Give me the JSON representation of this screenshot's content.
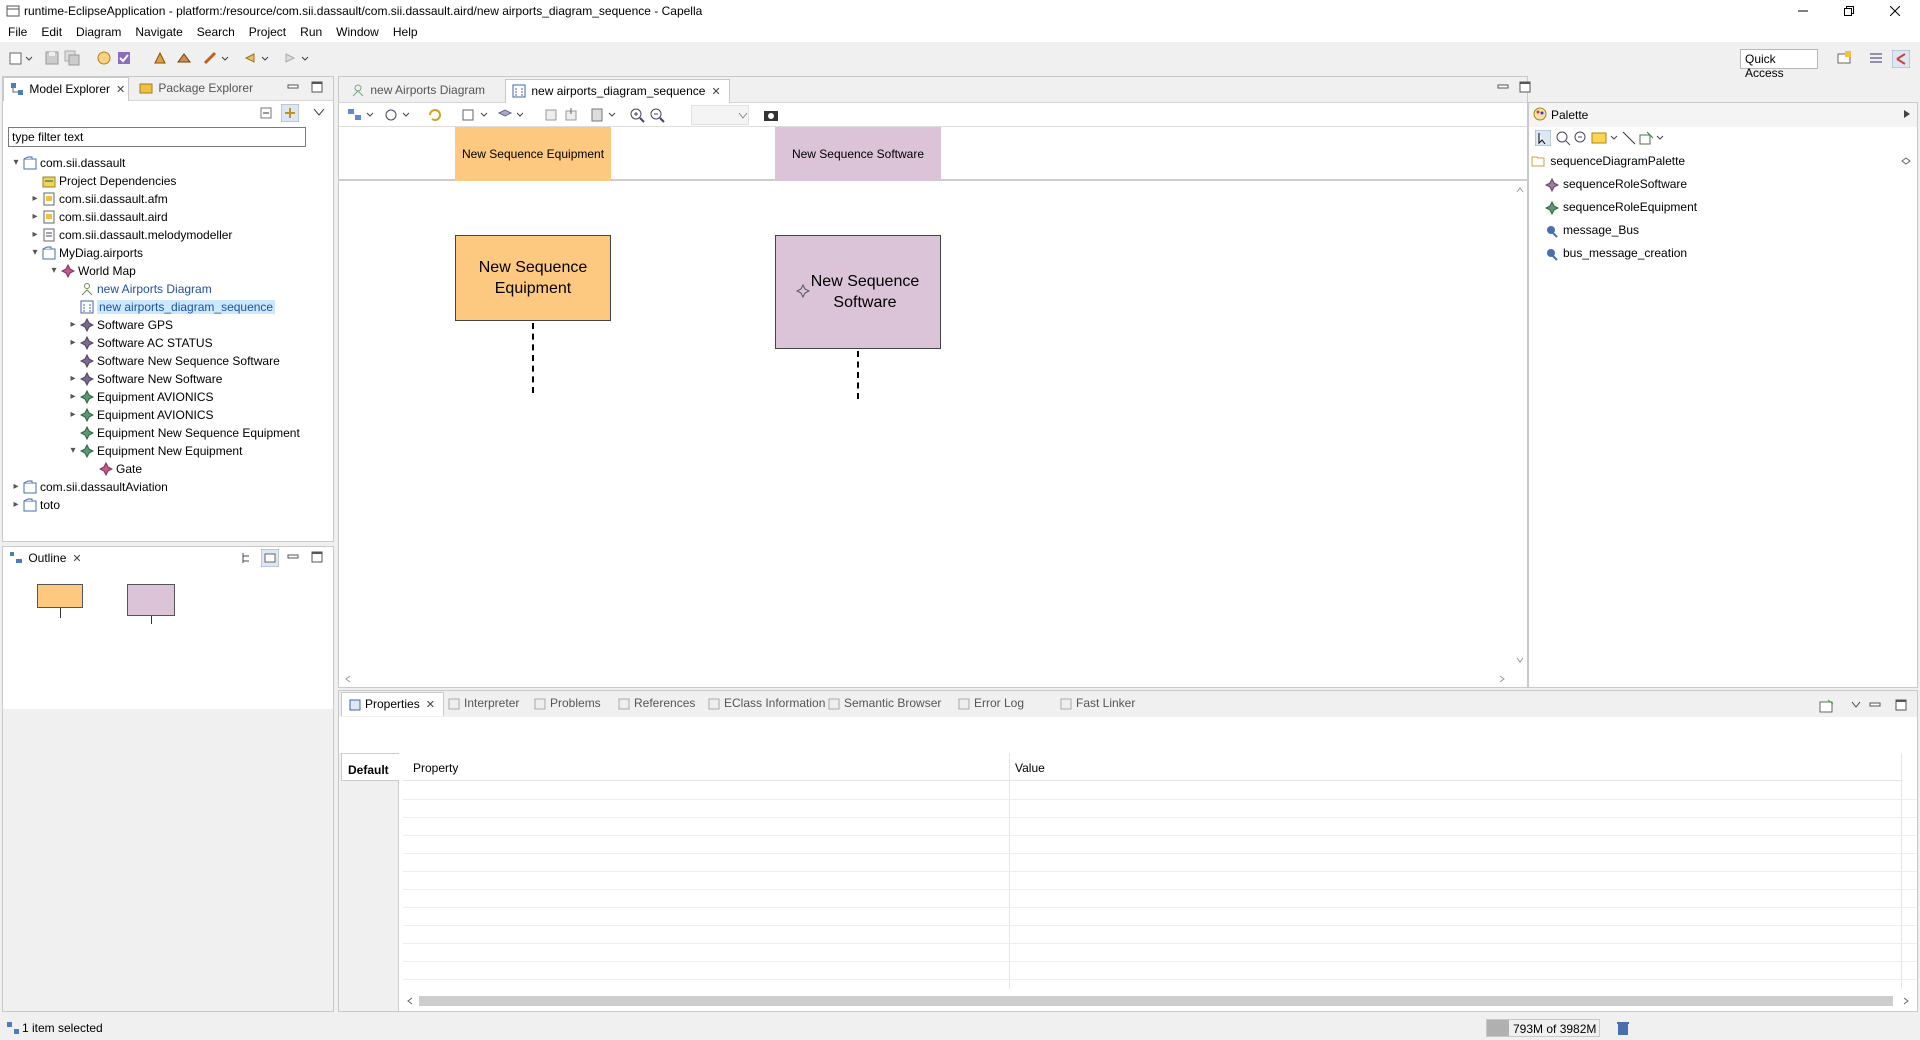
{
  "window": {
    "title": "runtime-EclipseApplication - platform:/resource/com.sii.dassault/com.sii.dassault.aird/new airports_diagram_sequence - Capella"
  },
  "menu": [
    "File",
    "Edit",
    "Diagram",
    "Navigate",
    "Search",
    "Project",
    "Run",
    "Window",
    "Help"
  ],
  "toolbar": {
    "quick_access": "Quick Access"
  },
  "model_explorer": {
    "tabs": [
      "Model Explorer",
      "Package Explorer"
    ],
    "filter_placeholder": "type filter text",
    "tree": [
      {
        "label": "com.sii.dassault",
        "arrow": "▾",
        "icon": "project-icon"
      },
      {
        "label": "Project Dependencies",
        "arrow": "",
        "icon": "dependencies-icon"
      },
      {
        "label": "com.sii.dassault.afm",
        "arrow": "▸",
        "icon": "file-icon"
      },
      {
        "label": "com.sii.dassault.aird",
        "arrow": "▸",
        "icon": "file-icon"
      },
      {
        "label": "com.sii.dassault.melodymodeller",
        "arrow": "▸",
        "icon": "model-icon"
      },
      {
        "label": "MyDiag.airports",
        "arrow": "▾",
        "icon": "package-icon"
      },
      {
        "label": "World Map",
        "arrow": "▾",
        "icon": "element-icon"
      },
      {
        "label": "new Airports Diagram",
        "arrow": "",
        "icon": "diagram-icon"
      },
      {
        "label": "new airports_diagram_sequence",
        "arrow": "",
        "icon": "sequence-diagram-icon"
      },
      {
        "label": "Software GPS",
        "arrow": "▸",
        "icon": "software-icon"
      },
      {
        "label": "Software AC STATUS",
        "arrow": "▸",
        "icon": "software-icon"
      },
      {
        "label": "Software New Sequence Software",
        "arrow": "",
        "icon": "software-icon"
      },
      {
        "label": "Software New Software",
        "arrow": "▸",
        "icon": "software-icon"
      },
      {
        "label": "Equipment AVIONICS",
        "arrow": "▸",
        "icon": "equipment-icon"
      },
      {
        "label": "Equipment AVIONICS",
        "arrow": "▸",
        "icon": "equipment-icon"
      },
      {
        "label": "Equipment New Sequence Equipment",
        "arrow": "",
        "icon": "equipment-icon"
      },
      {
        "label": "Equipment New Equipment",
        "arrow": "▾",
        "icon": "equipment-icon"
      },
      {
        "label": "Gate",
        "arrow": "",
        "icon": "gate-icon"
      },
      {
        "label": "com.sii.dassaultAviation",
        "arrow": "▸",
        "icon": "project-icon"
      },
      {
        "label": "toto",
        "arrow": "▸",
        "icon": "project-icon"
      }
    ]
  },
  "outline": {
    "tab": "Outline"
  },
  "editor": {
    "tabs": [
      "new Airports Diagram",
      "new airports_diagram_sequence"
    ],
    "header_boxes": [
      "New Sequence Equipment",
      "New Sequence Software"
    ],
    "boxes": [
      "New Sequence Equipment",
      "New Sequence Software"
    ],
    "colors": {
      "equipment": "#fdc980",
      "software": "#dbc3d8"
    }
  },
  "palette": {
    "title": "Palette",
    "group": "sequenceDiagramPalette",
    "items": [
      "sequenceRoleSoftware",
      "sequenceRoleEquipment",
      "message_Bus",
      "bus_message_creation"
    ]
  },
  "properties": {
    "tabs": [
      "Properties",
      "Interpreter",
      "Problems",
      "References",
      "EClass Information",
      "Semantic Browser",
      "Error Log",
      "Fast Linker"
    ],
    "sidebar_tab": "Default",
    "columns": [
      "Property",
      "Value"
    ]
  },
  "status": {
    "selection": "1 item selected",
    "memory": "793M of 3982M",
    "memory_fraction": 0.2
  }
}
